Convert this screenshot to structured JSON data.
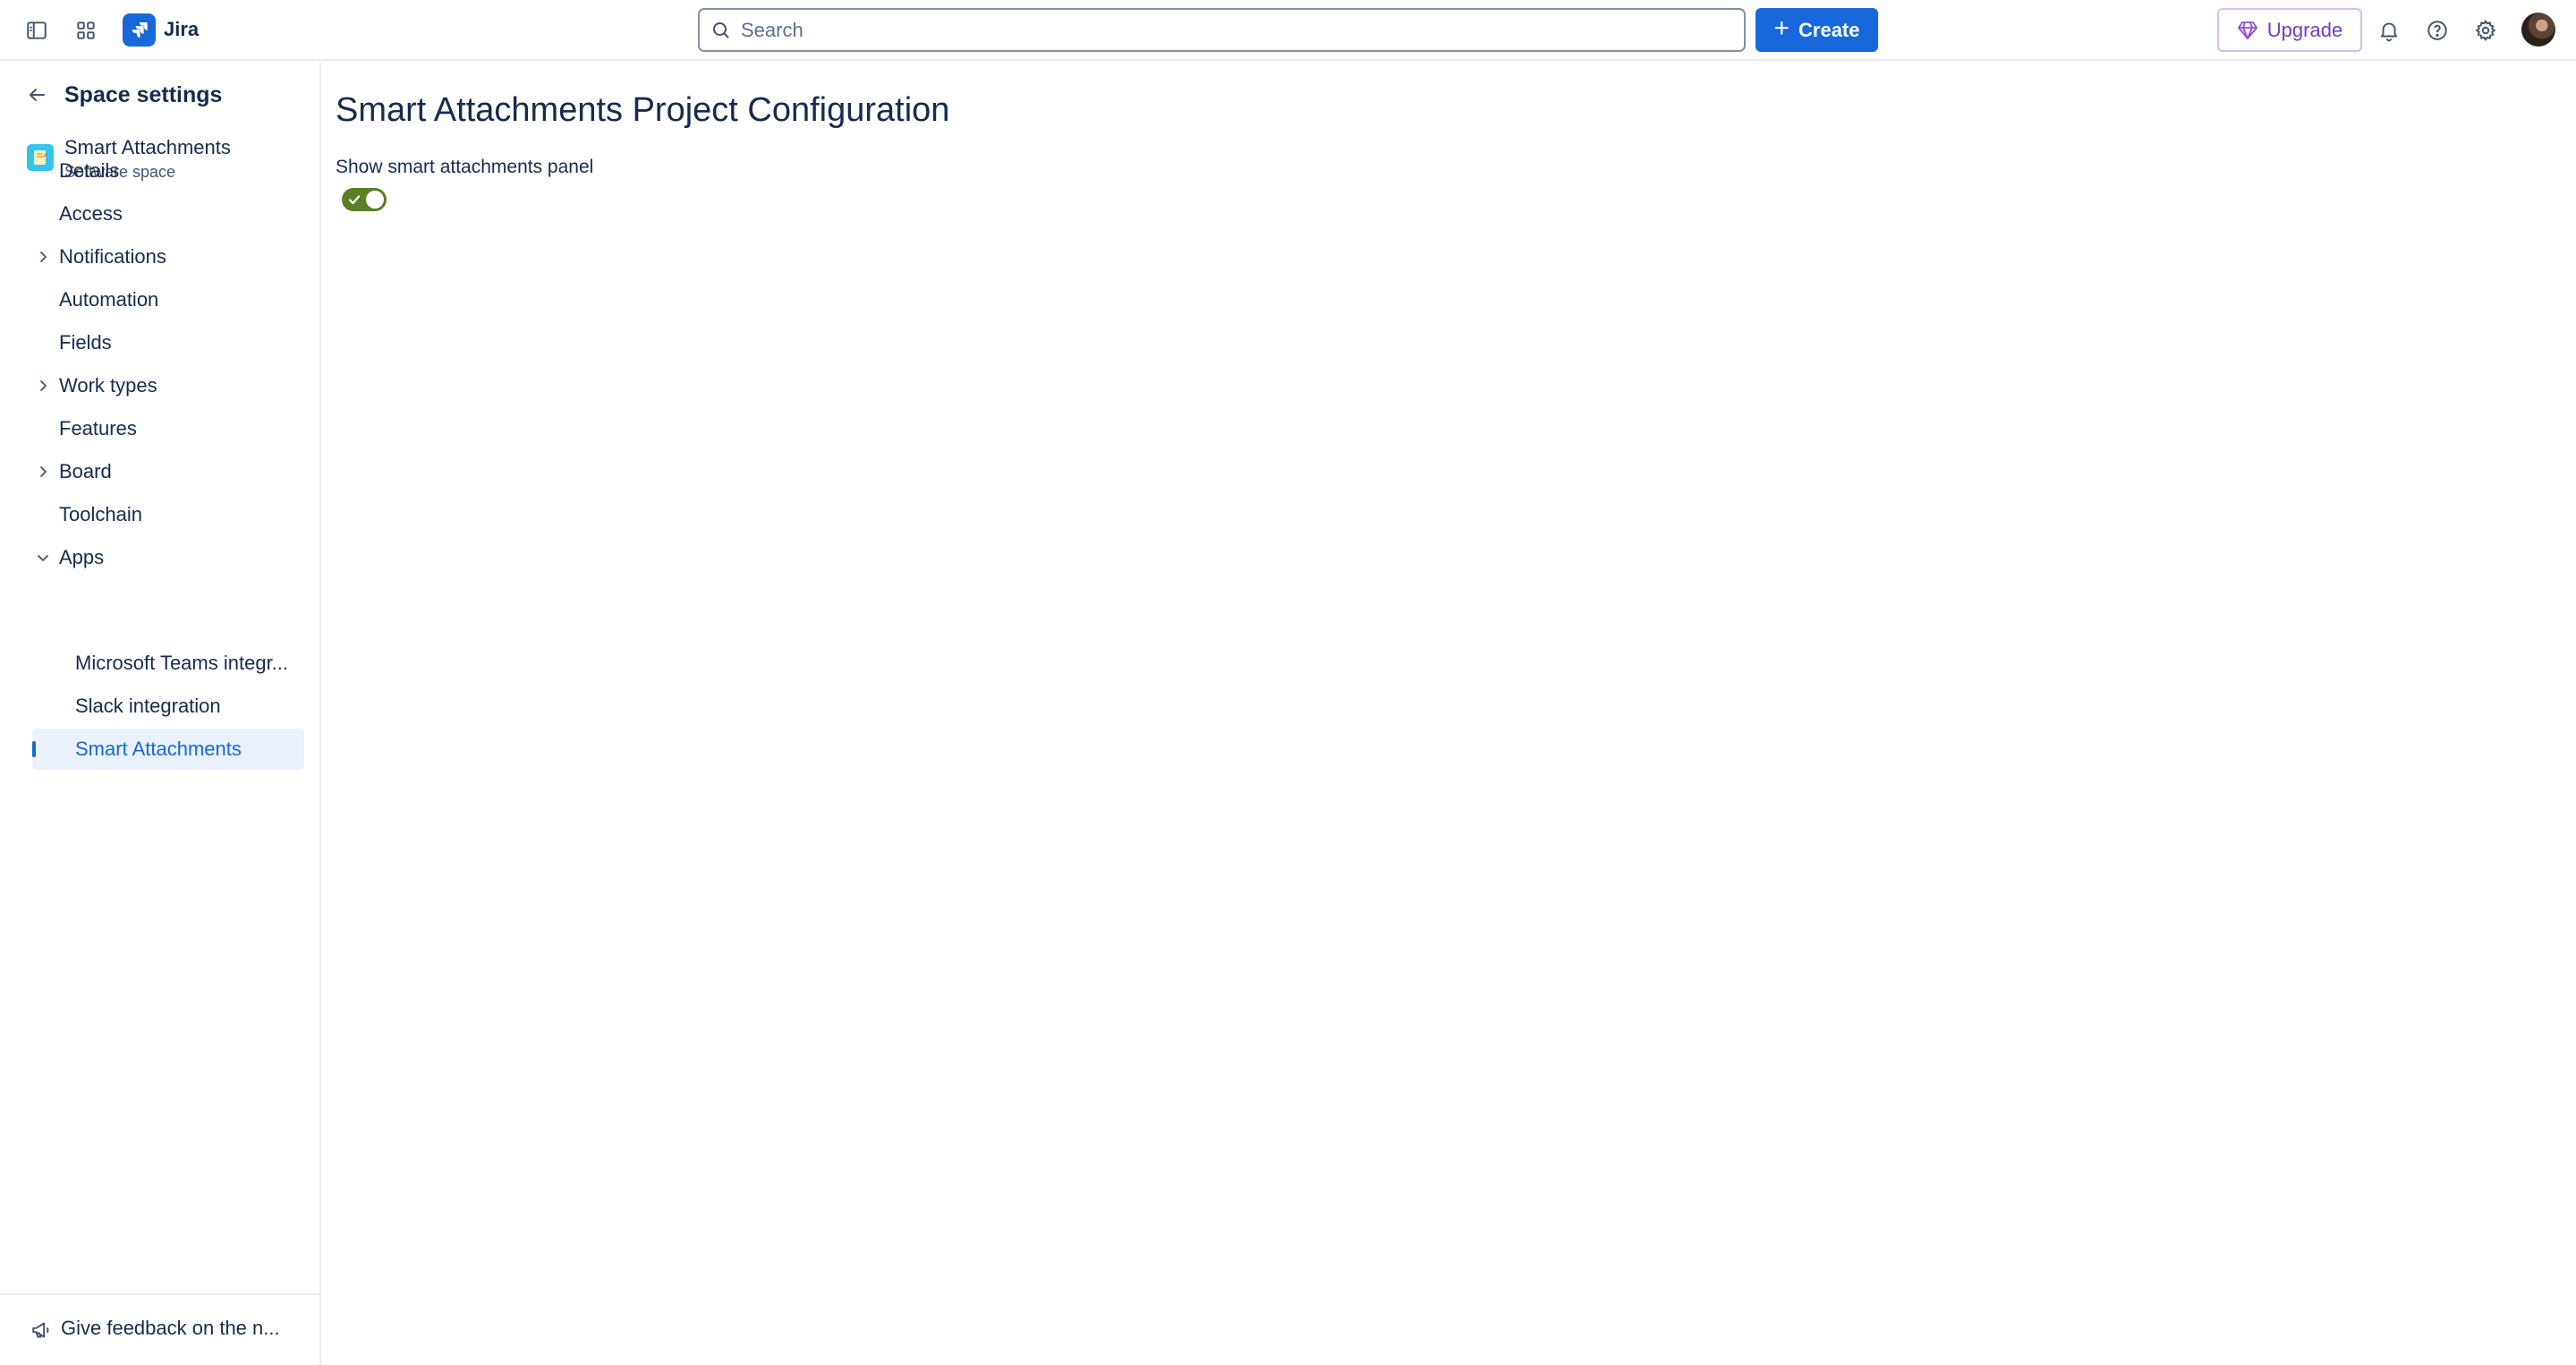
{
  "app": {
    "name": "Jira"
  },
  "topbar": {
    "search_placeholder": "Search",
    "create_label": "Create",
    "upgrade_label": "Upgrade"
  },
  "sidebar": {
    "back_title": "Space settings",
    "project_name": "Smart Attachments",
    "project_type": "Software space",
    "items": [
      {
        "label": "Details",
        "expandable": false
      },
      {
        "label": "Access",
        "expandable": false
      },
      {
        "label": "Notifications",
        "expandable": true,
        "expanded": false
      },
      {
        "label": "Automation",
        "expandable": false
      },
      {
        "label": "Fields",
        "expandable": false
      },
      {
        "label": "Work types",
        "expandable": true,
        "expanded": false
      },
      {
        "label": "Features",
        "expandable": false
      },
      {
        "label": "Board",
        "expandable": true,
        "expanded": false
      },
      {
        "label": "Toolchain",
        "expandable": false
      },
      {
        "label": "Apps",
        "expandable": true,
        "expanded": true
      }
    ],
    "apps_children": [
      {
        "label": "Microsoft Teams integr...",
        "active": false
      },
      {
        "label": "Slack integration",
        "active": false
      },
      {
        "label": "Smart Attachments",
        "active": true
      }
    ],
    "feedback_label": "Give feedback on the n..."
  },
  "main": {
    "title": "Smart Attachments Project Configuration",
    "setting_label": "Show smart attachments panel",
    "toggle_on": true
  },
  "colors": {
    "brand": "#1868db",
    "upgrade": "#6e3fc4",
    "toggle_on": "#5b7f24",
    "active_bg": "#e9f2fe"
  },
  "icons": [
    "sidebar-toggle-icon",
    "app-switcher-icon",
    "jira-logo-icon",
    "search-icon",
    "plus-icon",
    "gem-icon",
    "bell-icon",
    "help-icon",
    "gear-icon",
    "back-arrow-icon",
    "chevron-right-icon",
    "chevron-down-icon",
    "megaphone-icon",
    "check-icon"
  ]
}
